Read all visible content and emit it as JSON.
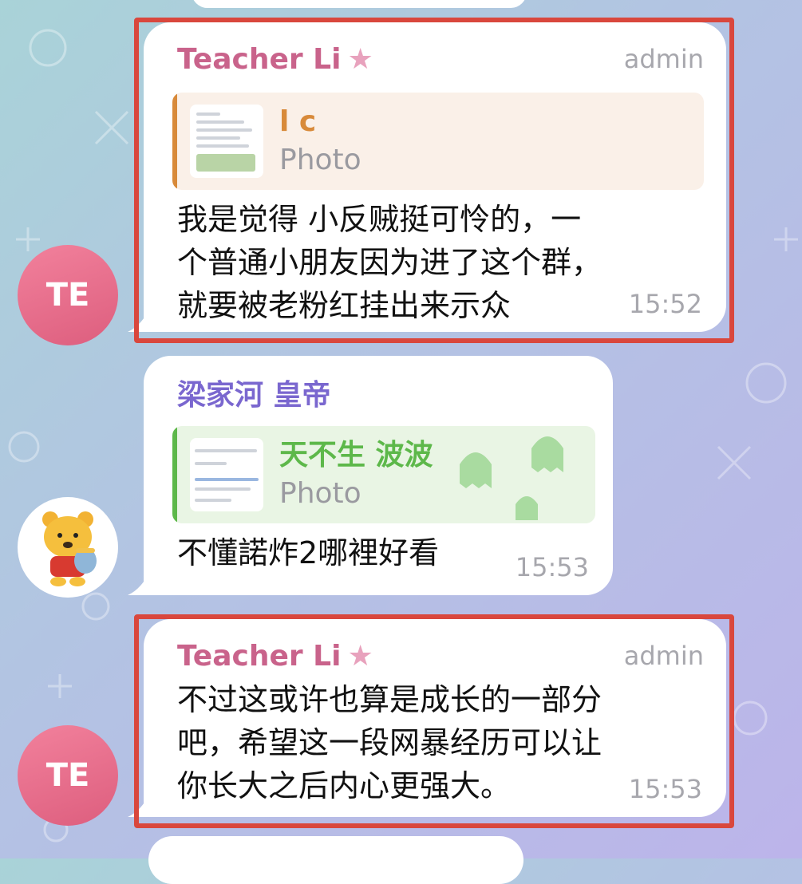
{
  "messages": [
    {
      "sender": "Teacher Li",
      "role": "admin",
      "reply": {
        "name": "l c",
        "type": "Photo"
      },
      "text": "我是觉得 小反贼挺可怜的，一\n个普通小朋友因为进了这个群，\n就要被老粉红挂出来示众",
      "time": "15:52",
      "avatar_text": "TE"
    },
    {
      "sender": "梁家河 皇帝",
      "reply": {
        "name": "天不生 波波",
        "type": "Photo"
      },
      "text": "不懂諾炸2哪裡好看",
      "time": "15:53"
    },
    {
      "sender": "Teacher Li",
      "role": "admin",
      "text": "不过这或许也算是成长的一部分\n吧，希望这一段网暴经历可以让\n你长大之后内心更强大。",
      "time": "15:53",
      "avatar_text": "TE"
    }
  ],
  "colors": {
    "admin_name": "#c9638b",
    "user_name": "#7a67cf",
    "reply1_accent": "#d88a3a",
    "reply2_accent": "#5db84a",
    "highlight": "#d9473d"
  },
  "icons": {
    "badge": "star-icon",
    "pooh": "winnie-the-pooh-avatar"
  }
}
